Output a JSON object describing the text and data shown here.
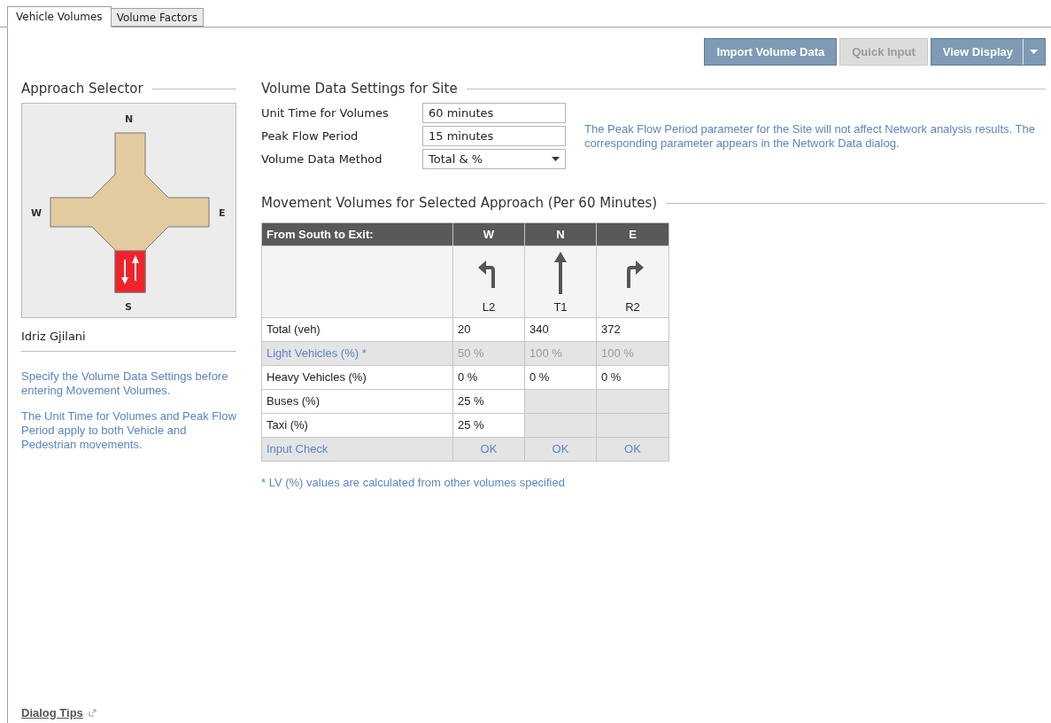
{
  "tabs": [
    {
      "label": "Vehicle Volumes",
      "selected": true
    },
    {
      "label": "Volume Factors",
      "selected": false
    }
  ],
  "toolbar": [
    {
      "label": "Import Volume Data",
      "disabled": false,
      "dropdown": false
    },
    {
      "label": "Quick Input",
      "disabled": true,
      "dropdown": false
    },
    {
      "label": "View Display",
      "disabled": false,
      "dropdown": true
    }
  ],
  "approach_selector": {
    "title": "Approach Selector",
    "approaches": [
      {
        "label": "N",
        "selected": false
      },
      {
        "label": "W",
        "selected": false
      },
      {
        "label": "E",
        "selected": false
      },
      {
        "label": "S",
        "selected": true
      }
    ],
    "site_name": "Idriz Gjilani",
    "notes": [
      "Specify the Volume Data Settings before entering Movement Volumes.",
      "The Unit Time for Volumes and Peak Flow Period apply to both Vehicle and Pedestrian movements."
    ]
  },
  "settings": {
    "title": "Volume Data Settings for Site",
    "fields": [
      {
        "label": "Unit Time for Volumes",
        "value": "60 minutes",
        "kind": "text"
      },
      {
        "label": "Peak Flow Period",
        "value": "15 minutes",
        "kind": "text"
      },
      {
        "label": "Volume Data Method",
        "value": "Total & %",
        "kind": "dropdown"
      }
    ],
    "note": "The Peak Flow Period parameter for the Site will not affect Network analysis results. The corresponding parameter appears in the Network Data dialog."
  },
  "movements": {
    "title": "Movement Volumes for Selected Approach (Per 60 Minutes)",
    "header": "From South to Exit:",
    "columns": [
      {
        "exit": "W",
        "kind": "left",
        "code": "L2"
      },
      {
        "exit": "N",
        "kind": "through",
        "code": "T1"
      },
      {
        "exit": "E",
        "kind": "right",
        "code": "R2"
      }
    ],
    "rows": [
      {
        "label": "Total (veh)",
        "kind": "input",
        "cells": [
          "20",
          "340",
          "372"
        ]
      },
      {
        "label": "Light Vehicles (%) *",
        "kind": "calc",
        "cells": [
          "50 %",
          "100 %",
          "100 %"
        ]
      },
      {
        "label": "Heavy Vehicles (%)",
        "kind": "input",
        "cells": [
          "0 %",
          "0 %",
          "0 %"
        ]
      },
      {
        "label": "Buses (%)",
        "kind": "input",
        "cells": [
          "25 %"
        ]
      },
      {
        "label": "Taxi (%)",
        "kind": "input",
        "cells": [
          "25 %"
        ]
      },
      {
        "label": "Input Check",
        "kind": "check",
        "cells": [
          "OK",
          "OK",
          "OK"
        ]
      }
    ],
    "footnote": "* LV (%) values are calculated from other volumes specified"
  },
  "dialog_tips": "Dialog Tips"
}
